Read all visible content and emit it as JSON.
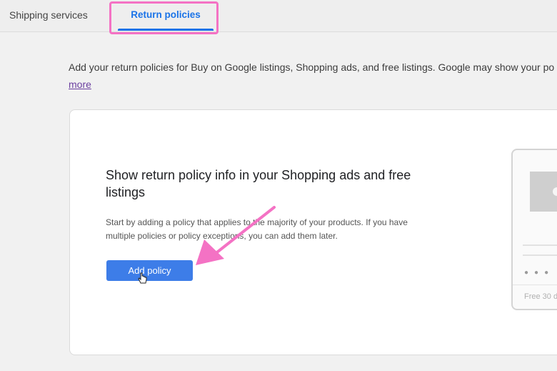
{
  "tabs": {
    "shipping_label": "Shipping services",
    "return_label": "Return policies",
    "active": "Return policies"
  },
  "intro": {
    "text": "Add your return policies for Buy on Google listings, Shopping ads, and free listings. Google may show your po",
    "more_link": "more"
  },
  "card": {
    "title": "Show return policy info in your Shopping ads and free listings",
    "description": "Start by adding a policy that applies to the majority of your products. If you have multiple policies or policy exceptions, you can add them later.",
    "add_button": "Add policy"
  },
  "illustration": {
    "free_text": "Free 30 d"
  },
  "colors": {
    "accent": "#1a73e8",
    "button": "#3d7de8",
    "annotation": "#f472c4",
    "link": "#6b3fa0"
  }
}
